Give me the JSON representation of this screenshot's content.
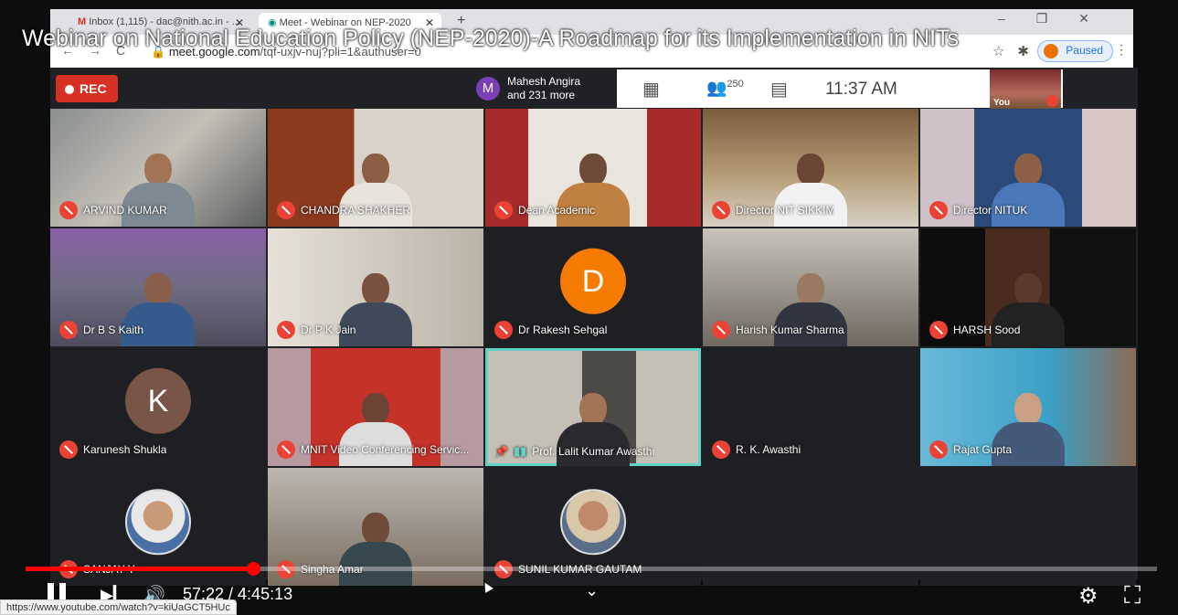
{
  "browser": {
    "tabs": [
      {
        "label": "Inbox (1,115) - dac@nith.ac.in - ..."
      },
      {
        "label": "Meet - Webinar on NEP-2020"
      }
    ],
    "url_domain": "meet.google.com",
    "url_path": "/tqf-uxjv-nuj?pli=1&authuser=0",
    "profile_status": "Paused"
  },
  "video": {
    "title": "Webinar on National Education Policy (NEP-2020)-A Roadmap for its Implementation in NITs"
  },
  "meet": {
    "rec_label": "REC",
    "presenter_initial": "M",
    "presenter_line1": "Mahesh Angira",
    "presenter_line2": "and 231 more",
    "people_count": "250",
    "clock": "11:37 AM",
    "self_label": "You",
    "tiles": [
      {
        "name": "ARVIND KUMAR",
        "muted": true
      },
      {
        "name": "CHANDRA SHAKHER",
        "muted": true
      },
      {
        "name": "Dean Academic",
        "muted": true
      },
      {
        "name": "Director NIT SIKKIM",
        "muted": true
      },
      {
        "name": "Director NITUK",
        "muted": true
      },
      {
        "name": "Dr B S Kaith",
        "muted": true
      },
      {
        "name": "Dr P K Jain",
        "muted": true
      },
      {
        "name": "Dr Rakesh Sehgal",
        "muted": true,
        "initial": "D",
        "color": "#f57c00"
      },
      {
        "name": "Harish Kumar Sharma",
        "muted": true
      },
      {
        "name": "HARSH Sood",
        "muted": true
      },
      {
        "name": "Karunesh Shukla",
        "muted": true,
        "initial": "K",
        "color": "#795548"
      },
      {
        "name": "MNIT Video Conferencing Servic...",
        "muted": true
      },
      {
        "name": "Prof. Lalit Kumar Awasthi",
        "muted": false,
        "active": true
      },
      {
        "name": "R. K. Awasthi",
        "muted": true
      },
      {
        "name": "Rajat Gupta",
        "muted": true
      },
      {
        "name": "SANJAY Y",
        "muted": true
      },
      {
        "name": "Singha Amar",
        "muted": true
      },
      {
        "name": "SUNIL KUMAR GAUTAM",
        "muted": true
      }
    ]
  },
  "player": {
    "current_time": "57:22",
    "duration": "4:45:13",
    "time_display": "57:22 / 4:45:13",
    "progress_fraction": 0.2013,
    "status_url": "https://www.youtube.com/watch?v=kiUaGCT5HUc"
  },
  "colors": {
    "accent_red": "#ff0000",
    "meet_red": "#ea4335",
    "active_outline": "#5fd3c4"
  }
}
